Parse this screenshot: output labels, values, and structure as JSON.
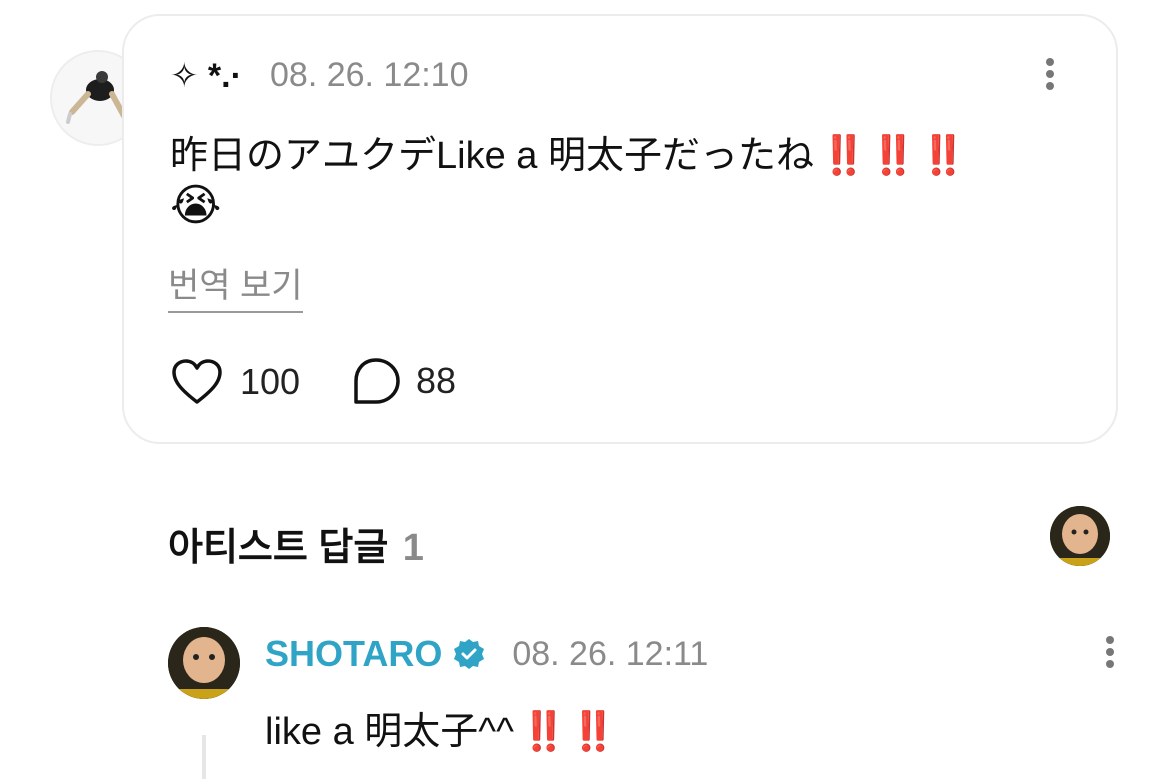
{
  "comment": {
    "author": "✧ *.·",
    "timestamp": "08. 26. 12:10",
    "text": "昨日のアユクデLike a 明太子だったね",
    "emphasis": "‼️ ‼️ ‼️",
    "emoji": "😭",
    "translate_label": "번역 보기",
    "likes": "100",
    "replies": "88"
  },
  "artist_replies": {
    "title": "아티스트 답글",
    "count": "1"
  },
  "reply": {
    "author": "SHOTARO",
    "verified": true,
    "timestamp": "08. 26. 12:11",
    "text": "like a 明太子^^",
    "emphasis": "‼️ ‼️"
  },
  "icons": {
    "like": "heart-icon",
    "comment": "comment-bubble-icon",
    "more": "more-vertical-icon",
    "verified": "verified-badge-icon"
  },
  "colors": {
    "artist_name": "#2fa4c6",
    "verified_badge": "#2fa4c6",
    "emphasis": "#e0262b",
    "meta": "#8a8a8a"
  }
}
